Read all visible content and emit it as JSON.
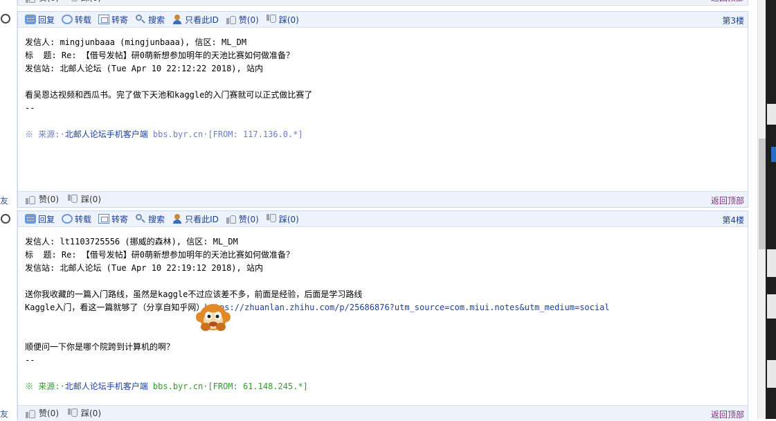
{
  "toolbar": {
    "reply": "回复",
    "forward": "转载",
    "mail_forward": "转寄",
    "search": "搜索",
    "only_this_id": "只看此ID",
    "like": "赞(0)",
    "dislike": "踩(0)"
  },
  "left_edge": {
    "friend_label": "友"
  },
  "bottom_bar": {
    "like": "赞(0)",
    "dislike": "踩(0)",
    "back_to_top": "返回顶部"
  },
  "posts": [
    {
      "floor": "第3楼",
      "sender": "发信人: mingjunbaaa (mingjunbaaa), 信区: ML_DM",
      "subject": "标  题: Re: 【借号发帖】研0萌新想参加明年的天池比赛如何做准备？",
      "station": "发信站: 北邮人论坛 (Tue Apr 10 22:12:22 2018), 站内",
      "body": [
        "看吴恩达视频和西瓜书。完了做下天池和kaggle的入门赛就可以正式做比赛了"
      ],
      "sig": "--",
      "source_prefix": "※ 来源:·",
      "source_app": "北邮人论坛手机客户端",
      "source_host": " bbs.byr.cn·[FROM: 117.136.0.*]"
    },
    {
      "floor": "第4楼",
      "sender": "发信人: lt1103725556 (挪威的森林), 信区: ML_DM",
      "subject": "标  题: Re: 【借号发帖】研0萌新想参加明年的天池比赛如何做准备？",
      "station": "发信站: 北邮人论坛 (Tue Apr 10 22:19:12 2018), 站内",
      "body": [
        "送你我收藏的一篇入门路线，虽然是kaggle不过应该差不多，前面是经验，后面是学习路线"
      ],
      "link_line_text": "Kaggle入门，看这一篇就够了（分享自知乎网）",
      "link_url": "https://zhuanlan.zhihu.com/p/25686876?utm_source=com.miui.notes&utm_medium=social",
      "question": "顺便问一下你是哪个院跨到计算机的啊？",
      "sig": "--",
      "source_prefix": "※ 来源:·",
      "source_app": "北邮人论坛手机客户端",
      "source_host": " bbs.byr.cn·[FROM: 61.148.245.*]"
    }
  ],
  "colors": {
    "link": "#1a3fa0",
    "source_green": "#2aa02a",
    "source_blue": "#6b7dc9",
    "back_top": "#7a2b7a"
  }
}
